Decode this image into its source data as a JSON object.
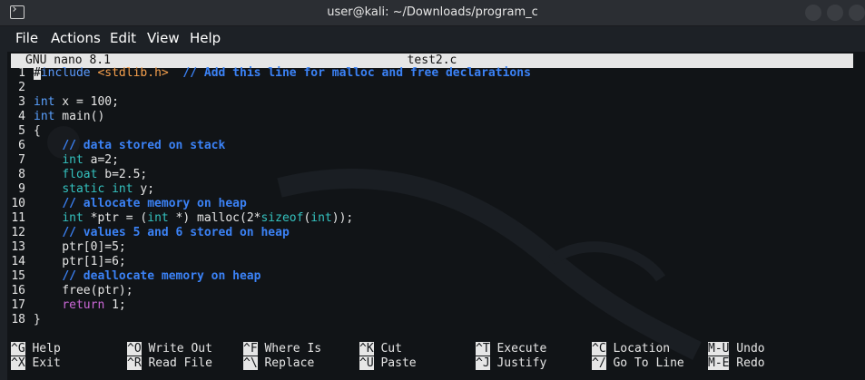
{
  "window": {
    "title": "user@kali: ~/Downloads/program_c",
    "icon": "terminal-icon"
  },
  "menu": [
    "File",
    "Actions",
    "Edit",
    "View",
    "Help"
  ],
  "nano": {
    "version": "GNU nano 8.1",
    "filename": "test2.c"
  },
  "code_lines": [
    {
      "n": "1",
      "segments": [
        {
          "t": "#",
          "c": "cursor"
        },
        {
          "t": "include ",
          "c": "prep"
        },
        {
          "t": "<stdlib.h>",
          "c": "inc"
        },
        {
          "t": "  ",
          "c": ""
        },
        {
          "t": "// Add this line for malloc and free declarations",
          "c": "comment"
        }
      ]
    },
    {
      "n": "2",
      "segments": []
    },
    {
      "n": "3",
      "segments": [
        {
          "t": "int",
          "c": "kw-blue"
        },
        {
          "t": " x = 100;",
          "c": ""
        }
      ]
    },
    {
      "n": "4",
      "segments": [
        {
          "t": "int",
          "c": "kw-blue"
        },
        {
          "t": " main()",
          "c": ""
        }
      ]
    },
    {
      "n": "5",
      "segments": [
        {
          "t": "{",
          "c": ""
        }
      ]
    },
    {
      "n": "6",
      "segments": [
        {
          "t": "    ",
          "c": ""
        },
        {
          "t": "// data stored on stack",
          "c": "comment"
        }
      ]
    },
    {
      "n": "7",
      "segments": [
        {
          "t": "    ",
          "c": ""
        },
        {
          "t": "int",
          "c": "kw"
        },
        {
          "t": " a=2;",
          "c": ""
        }
      ]
    },
    {
      "n": "8",
      "segments": [
        {
          "t": "    ",
          "c": ""
        },
        {
          "t": "float",
          "c": "kw"
        },
        {
          "t": " b=2.5;",
          "c": ""
        }
      ]
    },
    {
      "n": "9",
      "segments": [
        {
          "t": "    ",
          "c": ""
        },
        {
          "t": "static int",
          "c": "kw"
        },
        {
          "t": " y;",
          "c": ""
        }
      ]
    },
    {
      "n": "10",
      "segments": [
        {
          "t": "    ",
          "c": ""
        },
        {
          "t": "// allocate memory on heap",
          "c": "comment"
        }
      ]
    },
    {
      "n": "11",
      "segments": [
        {
          "t": "    ",
          "c": ""
        },
        {
          "t": "int",
          "c": "kw"
        },
        {
          "t": " *ptr = (",
          "c": ""
        },
        {
          "t": "int",
          "c": "kw"
        },
        {
          "t": " *) malloc(2*",
          "c": ""
        },
        {
          "t": "sizeof",
          "c": "kw"
        },
        {
          "t": "(",
          "c": ""
        },
        {
          "t": "int",
          "c": "kw"
        },
        {
          "t": "));",
          "c": ""
        }
      ]
    },
    {
      "n": "12",
      "segments": [
        {
          "t": "    ",
          "c": ""
        },
        {
          "t": "// values 5 and 6 stored on heap",
          "c": "comment"
        }
      ]
    },
    {
      "n": "13",
      "segments": [
        {
          "t": "    ptr[0]=5;",
          "c": ""
        }
      ]
    },
    {
      "n": "14",
      "segments": [
        {
          "t": "    ptr[1]=6;",
          "c": ""
        }
      ]
    },
    {
      "n": "15",
      "segments": [
        {
          "t": "    ",
          "c": ""
        },
        {
          "t": "// deallocate memory on heap",
          "c": "comment"
        }
      ]
    },
    {
      "n": "16",
      "segments": [
        {
          "t": "    free(ptr);",
          "c": ""
        }
      ]
    },
    {
      "n": "17",
      "segments": [
        {
          "t": "    ",
          "c": ""
        },
        {
          "t": "return",
          "c": "ret"
        },
        {
          "t": " 1;",
          "c": ""
        }
      ]
    },
    {
      "n": "18",
      "segments": [
        {
          "t": "}",
          "c": ""
        }
      ]
    }
  ],
  "shortcuts": [
    [
      {
        "key": "^G",
        "label": "Help"
      },
      {
        "key": "^O",
        "label": "Write Out"
      },
      {
        "key": "^F",
        "label": "Where Is"
      },
      {
        "key": "^K",
        "label": "Cut"
      },
      {
        "key": "^T",
        "label": "Execute"
      },
      {
        "key": "^C",
        "label": "Location"
      },
      {
        "key": "M-U",
        "label": "Undo"
      }
    ],
    [
      {
        "key": "^X",
        "label": "Exit"
      },
      {
        "key": "^R",
        "label": "Read File"
      },
      {
        "key": "^\\",
        "label": "Replace"
      },
      {
        "key": "^U",
        "label": "Paste"
      },
      {
        "key": "^J",
        "label": "Justify"
      },
      {
        "key": "^/",
        "label": "Go To Line"
      },
      {
        "key": "M-E",
        "label": "Redo"
      }
    ]
  ]
}
